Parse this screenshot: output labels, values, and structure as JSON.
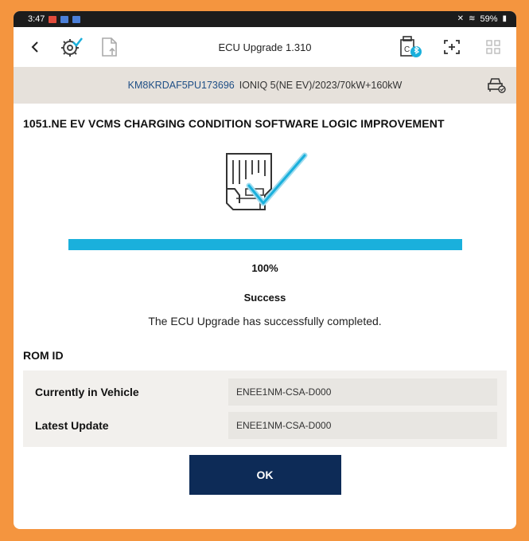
{
  "status_bar": {
    "time": "3:47",
    "battery": "59%"
  },
  "app_bar": {
    "title": "ECU Upgrade 1.310"
  },
  "vehicle": {
    "vin": "KM8KRDAF5PU173696",
    "description": "IONIQ 5(NE EV)/2023/70kW+160kW"
  },
  "update": {
    "title": "1051.NE EV VCMS CHARGING CONDITION SOFTWARE LOGIC IMPROVEMENT",
    "progress": 100,
    "progress_label": "100%",
    "status": "Success",
    "message": "The ECU Upgrade has successfully completed."
  },
  "rom": {
    "header": "ROM ID",
    "rows": [
      {
        "label": "Currently in Vehicle",
        "value": "ENEE1NM-CSA-D000"
      },
      {
        "label": "Latest Update",
        "value": "ENEE1NM-CSA-D000"
      }
    ]
  },
  "actions": {
    "ok_label": "OK"
  },
  "icons": {
    "back": "chevron-left-icon",
    "settings_check": "gear-check-icon",
    "document_upload": "document-upload-icon",
    "vci_bluetooth": "vci-bluetooth-icon",
    "screenshot": "screen-capture-icon",
    "grid": "grid-icon",
    "vehicle_settings": "vehicle-settings-icon",
    "ecu_success": "ecu-check-icon"
  },
  "colors": {
    "accent": "#1ab0dc",
    "primary_button": "#0d2b57",
    "frame": "#f4953f",
    "vin": "#1f4f86"
  }
}
